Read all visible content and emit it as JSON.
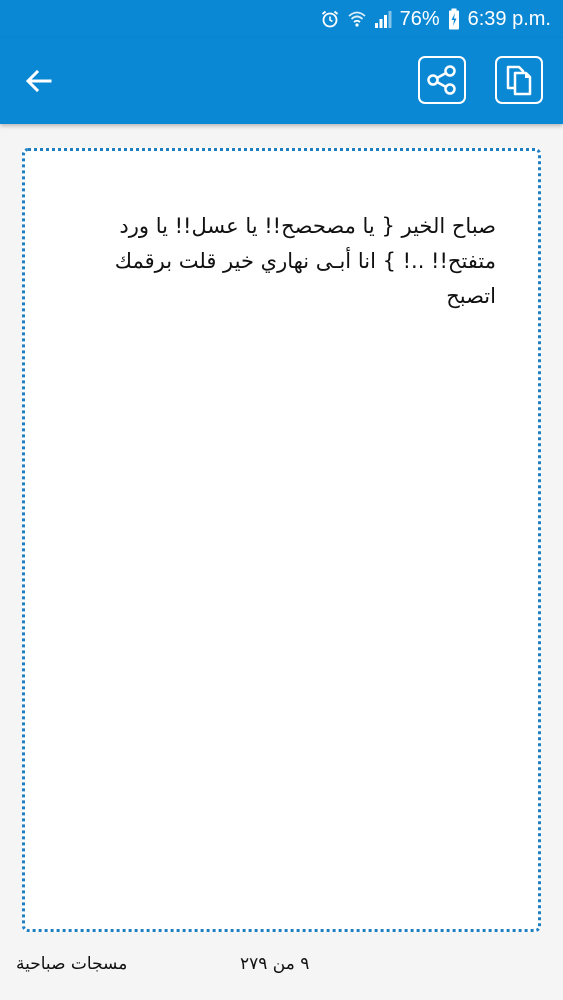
{
  "status_bar": {
    "battery": "76%",
    "time": "6:39 p.m.",
    "icons": [
      "alarm-icon",
      "wifi-icon",
      "signal-icon",
      "battery-charging-icon"
    ]
  },
  "app_bar": {
    "icons": [
      "back-arrow-icon",
      "share-icon",
      "copy-icon"
    ],
    "color": "#0a88d4"
  },
  "message": {
    "text": "صباح الخير { يا مصحصح!! يا عسل!! يا ورد متفتح!! ..! } انا أبـى نهاري خير قلت برقمك اتصبح",
    "border_color": "#1f7fc0"
  },
  "footer": {
    "category": "مسجات صباحية",
    "counter": "٩ من ٢٧٩"
  }
}
